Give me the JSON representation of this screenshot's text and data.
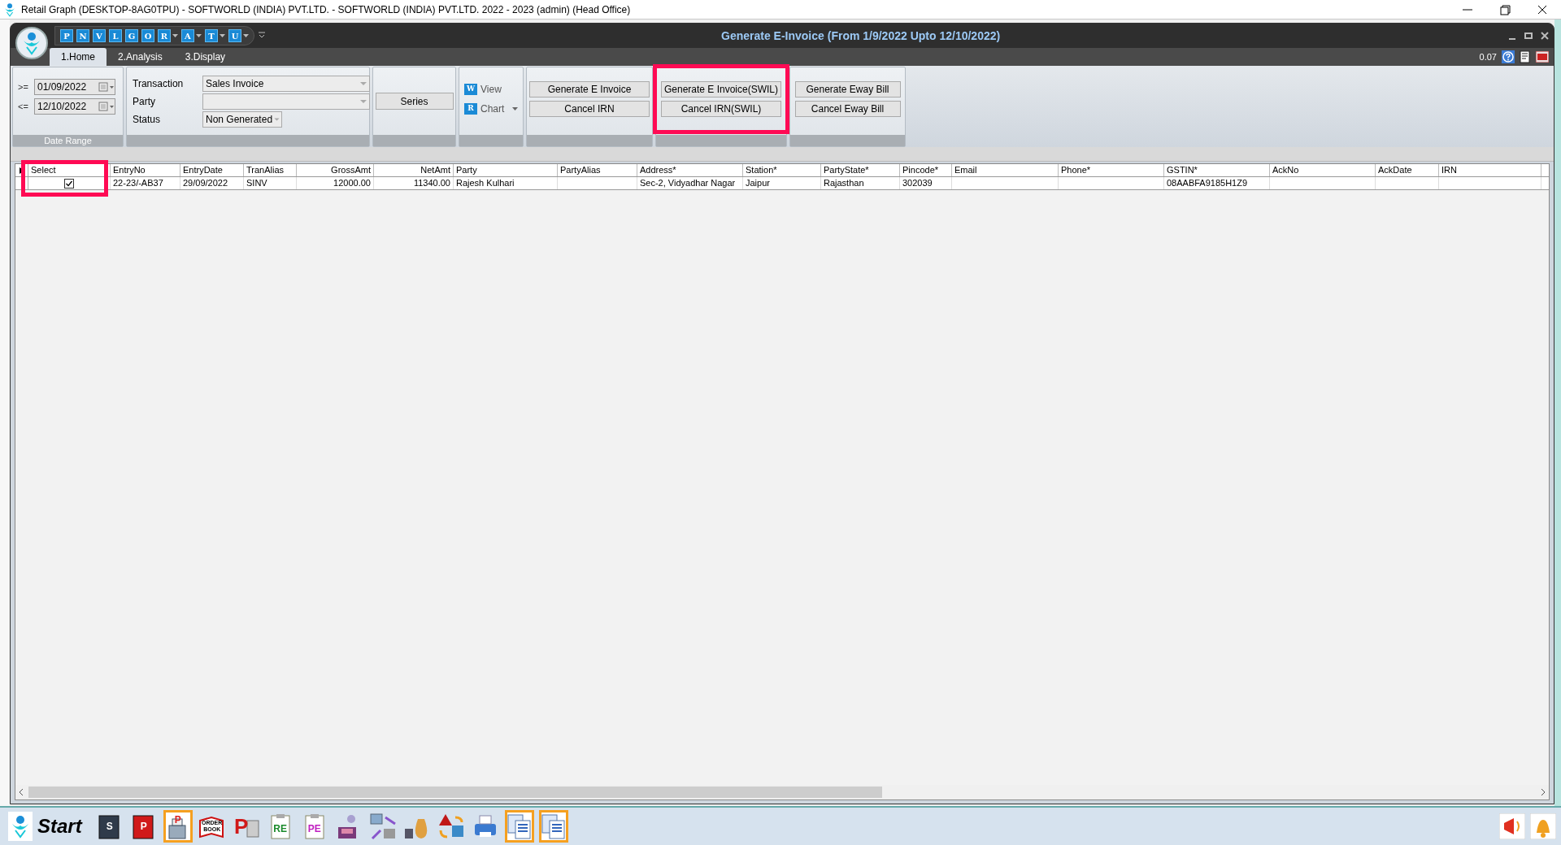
{
  "window": {
    "title": "Retail Graph (DESKTOP-8AG0TPU) - SOFTWORLD (INDIA) PVT.LTD. - SOFTWORLD (INDIA) PVT.LTD.  2022 - 2023 (admin) (Head Office)"
  },
  "app": {
    "title": "Generate E-Invoice (From 1/9/2022 Upto 12/10/2022)",
    "version": "0.07"
  },
  "quick_access": [
    {
      "letter": "P",
      "dropdown": false
    },
    {
      "letter": "N",
      "dropdown": false
    },
    {
      "letter": "V",
      "dropdown": false
    },
    {
      "letter": "L",
      "dropdown": false
    },
    {
      "letter": "G",
      "dropdown": false
    },
    {
      "letter": "O",
      "dropdown": false
    },
    {
      "letter": "R",
      "dropdown": true
    },
    {
      "letter": "A",
      "dropdown": true
    },
    {
      "letter": "T",
      "dropdown": true
    },
    {
      "letter": "U",
      "dropdown": true
    }
  ],
  "tabs": [
    {
      "label": "1.Home",
      "selected": true
    },
    {
      "label": "2.Analysis",
      "selected": false
    },
    {
      "label": "3.Display",
      "selected": false
    }
  ],
  "date_range": {
    "label": "Date Range",
    "fields": [
      {
        "operator": ">=",
        "value": "01/09/2022"
      },
      {
        "operator": "<=",
        "value": "12/10/2022"
      }
    ]
  },
  "filters": [
    {
      "label": "Transaction",
      "value": "Sales Invoice",
      "wide": true
    },
    {
      "label": "Party",
      "wide": true
    },
    {
      "label": "Status",
      "value": "Non Generated",
      "wide": false
    }
  ],
  "series_button": "Series",
  "view_menu": [
    {
      "letter": "W",
      "label": "View",
      "dropdown": false
    },
    {
      "letter": "R",
      "label": "Chart",
      "dropdown": true
    }
  ],
  "action_groups": [
    {
      "buttons": [
        "Generate E Invoice",
        "Cancel IRN"
      ],
      "highlighted": false
    },
    {
      "buttons": [
        "Generate E Invoice(SWIL)",
        "Cancel IRN(SWIL)"
      ],
      "highlighted": true
    },
    {
      "buttons": [
        "Generate Eway Bill",
        "Cancel Eway Bill"
      ],
      "highlighted": false
    }
  ],
  "table": {
    "select_highlighted": true,
    "columns": [
      {
        "label": "Select",
        "kind": "checkbox"
      },
      {
        "label": "EntryNo",
        "kind": "text"
      },
      {
        "label": "EntryDate",
        "kind": "text"
      },
      {
        "label": "TranAlias",
        "kind": "text"
      },
      {
        "label": "GrossAmt",
        "kind": "amount"
      },
      {
        "label": "NetAmt",
        "kind": "amount"
      },
      {
        "label": "Party",
        "kind": "text"
      },
      {
        "label": "PartyAlias",
        "kind": "text"
      },
      {
        "label": "Address*",
        "kind": "text"
      },
      {
        "label": "Station*",
        "kind": "text"
      },
      {
        "label": "PartyState*",
        "kind": "text"
      },
      {
        "label": "Pincode*",
        "kind": "text"
      },
      {
        "label": "Email",
        "kind": "text"
      },
      {
        "label": "Phone*",
        "kind": "text"
      },
      {
        "label": "GSTIN*",
        "kind": "text"
      },
      {
        "label": "AckNo",
        "kind": "text"
      },
      {
        "label": "AckDate",
        "kind": "text"
      },
      {
        "label": "IRN",
        "kind": "text"
      }
    ],
    "rows": [
      {
        "checked": true,
        "cells": [
          "",
          "22-23/-AB37",
          "29/09/2022",
          "SINV",
          "12000.00",
          "11340.00",
          "Rajesh Kulhari",
          "",
          "Sec-2, Vidyadhar Nagar",
          "Jaipur",
          "Rajasthan",
          "302039",
          "",
          "",
          "08AABFA9185H1Z9",
          "",
          "",
          ""
        ]
      }
    ]
  },
  "taskbar": {
    "start_label": "Start",
    "items": [
      {
        "kind": "book",
        "label": "S",
        "highlighted": false,
        "color": "#2f3b4a"
      },
      {
        "kind": "book",
        "label": "P",
        "highlighted": false,
        "color": "#d01a1a"
      },
      {
        "kind": "register",
        "label": "P",
        "highlighted": true
      },
      {
        "kind": "order-book",
        "label": "ORDER BOOK",
        "highlighted": false
      },
      {
        "kind": "big-letter",
        "label": "P",
        "highlighted": false
      },
      {
        "kind": "clipboard",
        "label": "RE",
        "highlighted": false,
        "color": "#1a8a2a"
      },
      {
        "kind": "clipboard",
        "label": "PE",
        "highlighted": false,
        "color": "#c020c0"
      },
      {
        "kind": "cashier",
        "highlighted": false
      },
      {
        "kind": "transfer",
        "highlighted": false
      },
      {
        "kind": "money-bag",
        "highlighted": false
      },
      {
        "kind": "shapes",
        "highlighted": false
      },
      {
        "kind": "printer",
        "highlighted": false
      },
      {
        "kind": "documents",
        "highlighted": true
      },
      {
        "kind": "documents",
        "highlighted": true
      }
    ]
  }
}
